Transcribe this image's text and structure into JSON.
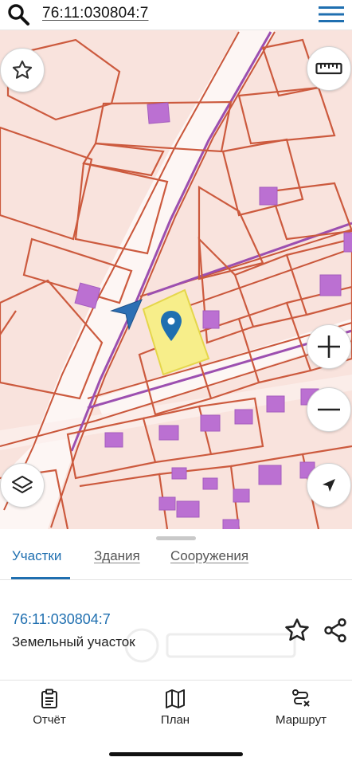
{
  "search": {
    "query": "76:11:030804:7"
  },
  "map": {
    "selected_parcel_color": "#f7ee8a",
    "pin_color": "#1f6fb0",
    "boundary_color": "#c9563a",
    "building_color": "#b86ed0"
  },
  "tabs": [
    {
      "label": "Участки",
      "active": true
    },
    {
      "label": "Здания",
      "active": false
    },
    {
      "label": "Сооружения",
      "active": false
    }
  ],
  "parcel": {
    "number": "76:11:030804:7",
    "type": "Земельный участок"
  },
  "nav": {
    "report": "Отчёт",
    "plan": "План",
    "route": "Маршрут"
  }
}
